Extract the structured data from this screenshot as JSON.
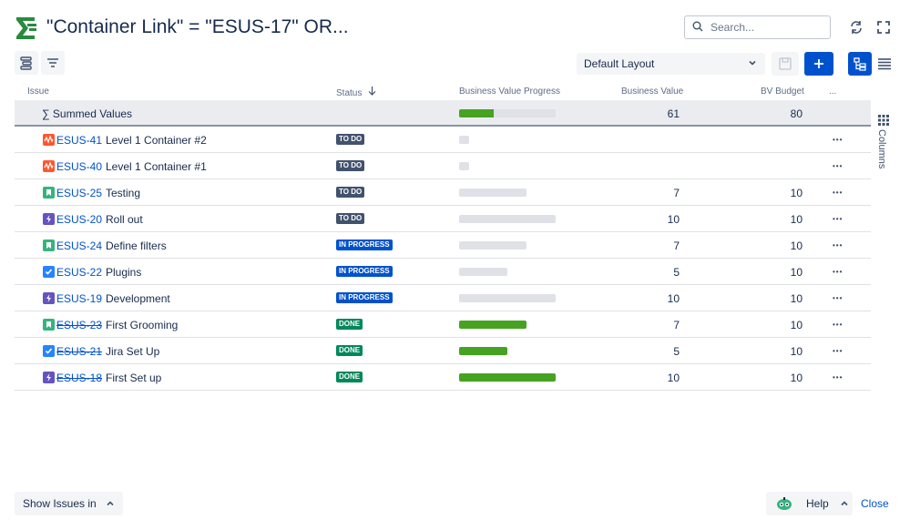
{
  "header": {
    "title": "\"Container Link\" = \"ESUS-17\" OR...",
    "search_placeholder": "Search..."
  },
  "toolbar": {
    "layout_value": "Default Layout"
  },
  "columns": {
    "issue": "Issue",
    "status": "Status",
    "progress": "Business Value Progress",
    "business_value": "Business Value",
    "bv_budget": "BV Budget",
    "more": "..."
  },
  "summary_row": {
    "label": "∑ Summed Values",
    "business_value": "61",
    "bv_budget": "80",
    "progress_fraction": 0.36
  },
  "rows": [
    {
      "key": "ESUS-41",
      "summary": "Level 1 Container #2",
      "type": "container",
      "status": "TO DO",
      "status_kind": "todo",
      "business_value": "",
      "bv_budget": "",
      "progress_fraction": 0,
      "track": 0.1,
      "resolved": false
    },
    {
      "key": "ESUS-40",
      "summary": "Level 1 Container #1",
      "type": "container",
      "status": "TO DO",
      "status_kind": "todo",
      "business_value": "",
      "bv_budget": "",
      "progress_fraction": 0,
      "track": 0.1,
      "resolved": false
    },
    {
      "key": "ESUS-25",
      "summary": "Testing",
      "type": "story",
      "status": "TO DO",
      "status_kind": "todo",
      "business_value": "7",
      "bv_budget": "10",
      "progress_fraction": 0,
      "track": 0.7,
      "resolved": false
    },
    {
      "key": "ESUS-20",
      "summary": "Roll out",
      "type": "epic",
      "status": "TO DO",
      "status_kind": "todo",
      "business_value": "10",
      "bv_budget": "10",
      "progress_fraction": 0,
      "track": 1.0,
      "resolved": false
    },
    {
      "key": "ESUS-24",
      "summary": "Define filters",
      "type": "story",
      "status": "IN PROGRESS",
      "status_kind": "inprogress",
      "business_value": "7",
      "bv_budget": "10",
      "progress_fraction": 0,
      "track": 0.7,
      "resolved": false
    },
    {
      "key": "ESUS-22",
      "summary": "Plugins",
      "type": "task",
      "status": "IN PROGRESS",
      "status_kind": "inprogress",
      "business_value": "5",
      "bv_budget": "10",
      "progress_fraction": 0,
      "track": 0.5,
      "resolved": false
    },
    {
      "key": "ESUS-19",
      "summary": "Development",
      "type": "epic",
      "status": "IN PROGRESS",
      "status_kind": "inprogress",
      "business_value": "10",
      "bv_budget": "10",
      "progress_fraction": 0,
      "track": 1.0,
      "resolved": false
    },
    {
      "key": "ESUS-23",
      "summary": "First Grooming",
      "type": "story",
      "status": "DONE",
      "status_kind": "done",
      "business_value": "7",
      "bv_budget": "10",
      "progress_fraction": 1,
      "track": 0.7,
      "resolved": true
    },
    {
      "key": "ESUS-21",
      "summary": "Jira Set Up",
      "type": "task",
      "status": "DONE",
      "status_kind": "done",
      "business_value": "5",
      "bv_budget": "10",
      "progress_fraction": 1,
      "track": 0.5,
      "resolved": true
    },
    {
      "key": "ESUS-18",
      "summary": "First Set up",
      "type": "epic",
      "status": "DONE",
      "status_kind": "done",
      "business_value": "10",
      "bv_budget": "10",
      "progress_fraction": 1,
      "track": 1.0,
      "resolved": true
    }
  ],
  "side_panel": {
    "columns_label": "Columns"
  },
  "footer": {
    "show_issues_label": "Show Issues in",
    "help_label": "Help",
    "close_label": "Close"
  },
  "colors": {
    "accent": "#0052cc",
    "progress_fill": "#45a321",
    "todo": "#42526e",
    "inprogress": "#0052cc",
    "done": "#00875a",
    "container_icon": "#ff5630",
    "story_icon": "#36b37e",
    "task_icon": "#2684ff",
    "epic_icon": "#6554c0"
  },
  "icons": [
    "structure-logo-icon",
    "search-icon",
    "refresh-icon",
    "fullscreen-icon",
    "hierarchy-icon",
    "filter-icon",
    "chevron-down-icon",
    "save-icon",
    "plus-icon",
    "tree-view-icon",
    "list-view-icon",
    "sort-arrow-icon",
    "columns-icon",
    "more-icon",
    "help-bot-icon",
    "chevron-up-icon"
  ]
}
